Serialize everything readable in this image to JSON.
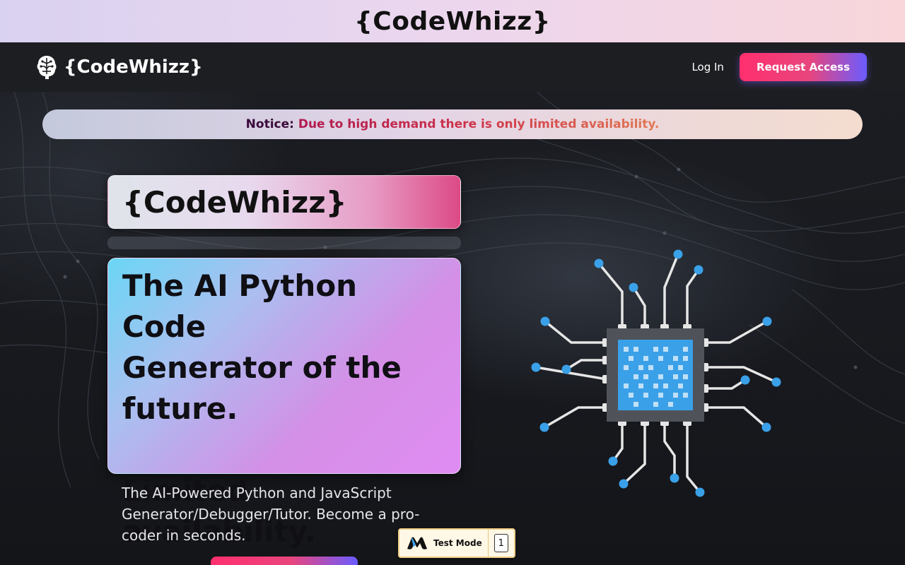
{
  "top_banner": {
    "title": "{CodeWhizz}"
  },
  "navbar": {
    "brand": "{CodeWhizz}",
    "login": "Log In",
    "request_access": "Request Access"
  },
  "notice": {
    "label": "Notice:",
    "text": "Due to high demand there is only limited availability."
  },
  "hero": {
    "card_title": "{CodeWhizz}",
    "headline": "The AI Python Code\nGenerator of the\nfuture.\n\nLimited availability.",
    "tagline": "The AI-Powered Python and JavaScript Generator/Debugger/Tutor. Become a pro-coder in seconds."
  },
  "test_badge": {
    "label": "Test Mode",
    "count": "1"
  },
  "colors": {
    "accent_pink": "#ff2f6e",
    "accent_purple": "#6a5cff",
    "chip_blue": "#3aa0e8",
    "background": "#15171c"
  },
  "icons": [
    "brain-circuit-icon",
    "cpu-chip-icon",
    "test-mode-logo-icon"
  ]
}
